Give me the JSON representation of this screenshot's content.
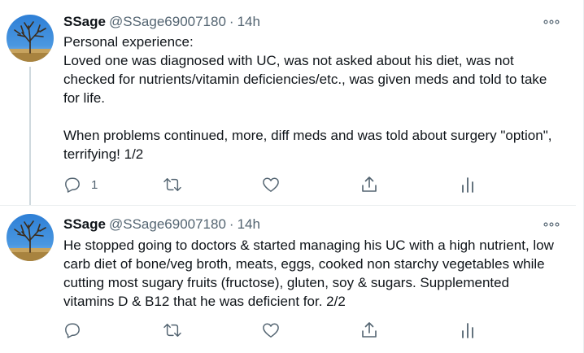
{
  "tweets": [
    {
      "author": "SSage",
      "handle": "@SSage69007180",
      "separator": "·",
      "time": "14h",
      "text_lines": [
        "Personal experience:",
        "Loved one was diagnosed with UC, was not asked about his diet, was not checked for nutrients/vitamin deficiencies/etc., was given meds and told to take for life.",
        "",
        "When problems continued, more, diff meds and was told about surgery \"option\", terrifying! 1/2"
      ],
      "reply_count": "1"
    },
    {
      "author": "SSage",
      "handle": "@SSage69007180",
      "separator": "·",
      "time": "14h",
      "text_lines": [
        "He stopped going to doctors & started managing his UC with a high nutrient, low carb diet of bone/veg broth, meats, eggs, cooked non starchy vegetables while cutting most sugary fruits (fructose), gluten, soy & sugars. Supplemented vitamins D & B12 that he was deficient for. 2/2"
      ],
      "reply_count": ""
    }
  ],
  "icons": {
    "more": "more-horizontal-icon",
    "reply": "reply-icon",
    "retweet": "retweet-icon",
    "like": "heart-icon",
    "share": "share-icon",
    "analytics": "analytics-icon"
  },
  "colors": {
    "text": "#0f1419",
    "secondary": "#536471",
    "divider": "#ebeef0",
    "thread_line": "#cfd9de"
  }
}
